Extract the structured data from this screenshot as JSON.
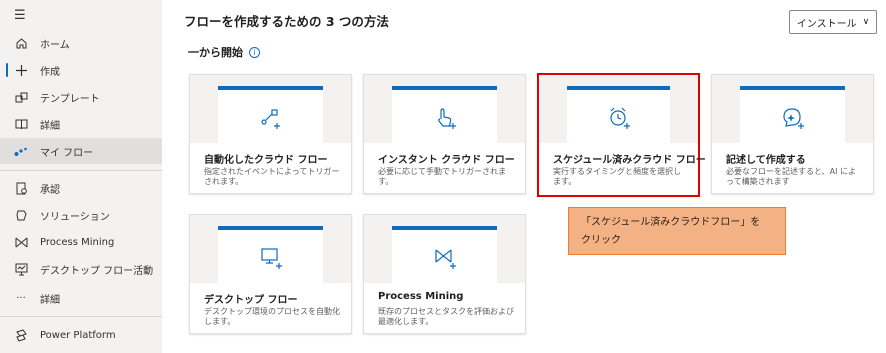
{
  "sidebar": {
    "menu_icon": "hamburger-icon",
    "items": [
      {
        "label": "ホーム",
        "icon": "home-icon"
      },
      {
        "label": "作成",
        "icon": "plus-icon"
      },
      {
        "label": "テンプレート",
        "icon": "template-icon"
      },
      {
        "label": "詳細",
        "icon": "book-icon"
      },
      {
        "label": "マイ フロー",
        "icon": "flow-icon"
      },
      {
        "label": "承認",
        "icon": "approval-icon"
      },
      {
        "label": "ソリューション",
        "icon": "solution-icon"
      },
      {
        "label": "Process Mining",
        "icon": "process-mining-icon"
      },
      {
        "label": "デスクトップ フロー活動",
        "icon": "desktop-activity-icon"
      },
      {
        "label": "詳細",
        "icon": "more-icon"
      },
      {
        "label": "Power Platform",
        "icon": "power-platform-icon"
      }
    ]
  },
  "header": {
    "title": "フローを作成するための 3 つの方法",
    "install_label": "インストール"
  },
  "section": {
    "heading": "一から開始",
    "info_glyph": "i"
  },
  "cards": [
    {
      "title": "自動化したクラウド フロー",
      "desc": "指定されたイベントによってトリガーされます。",
      "icon": "automated-flow-icon"
    },
    {
      "title": "インスタント クラウド フロー",
      "desc": "必要に応じて手動でトリガーされます。",
      "icon": "instant-flow-icon"
    },
    {
      "title": "スケジュール済みクラウド フロー",
      "desc": "実行するタイミングと頻度を選択します。",
      "icon": "scheduled-flow-icon"
    },
    {
      "title": "記述して作成する",
      "desc": "必要なフローを記述すると、AI によって構築されます",
      "icon": "describe-ai-icon"
    },
    {
      "title": "デスクトップ フロー",
      "desc": "デスクトップ環境のプロセスを自動化します。",
      "icon": "desktop-flow-icon"
    },
    {
      "title": "Process Mining",
      "desc": "既存のプロセスとタスクを評価および最適化します。",
      "icon": "process-mining-card-icon"
    }
  ],
  "callout": {
    "line1": "「スケジュール済みクラウドフロー」を",
    "line2": "クリック"
  },
  "colors": {
    "accent": "#0f6cbd",
    "highlight_border": "#e00000",
    "callout_fill": "#f4b183"
  }
}
